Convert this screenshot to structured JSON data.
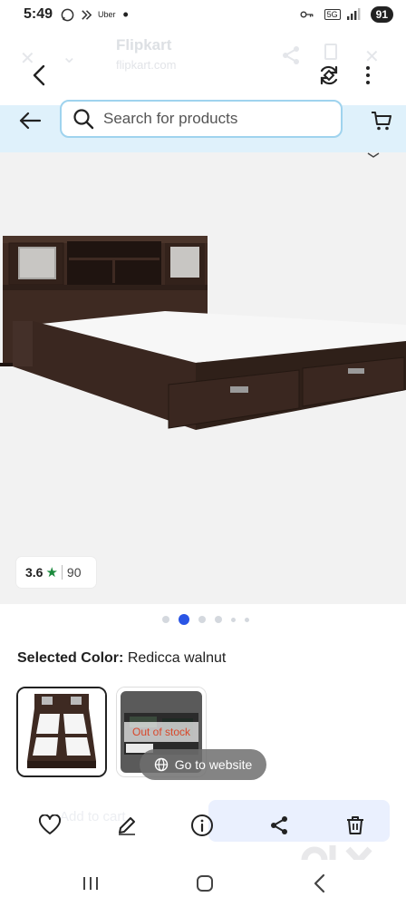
{
  "status_bar": {
    "time": "5:49",
    "notif_app": "Uber",
    "dot": "•",
    "net_tag": "5G",
    "battery": "91"
  },
  "ghost_header": {
    "title": "Flipkart",
    "subtitle": "flipkart.com"
  },
  "search": {
    "placeholder": "Search for products"
  },
  "product": {
    "rating": "3.6",
    "rating_star": "★",
    "rating_count": "90",
    "image_count": 6,
    "active_image": 2
  },
  "color_selector": {
    "label": "Selected Color:",
    "value": "Redicca walnut",
    "options": [
      {
        "name": "Redicca walnut",
        "selected": true,
        "status": ""
      },
      {
        "name": "other",
        "selected": false,
        "status": "Out of stock"
      }
    ]
  },
  "overlay": {
    "goto_label": "Go to website"
  },
  "action_bar": {
    "ghost_left": "Add to cart",
    "icons": [
      "heart-icon",
      "edit-icon",
      "info-icon",
      "share-icon",
      "trash-icon"
    ]
  },
  "colors": {
    "accent": "#2a55e5",
    "search_strip": "#dff1fb",
    "rating_star": "#1a8a3c",
    "out_of_stock": "#d9472b",
    "wood_dark": "#3e2a22"
  }
}
